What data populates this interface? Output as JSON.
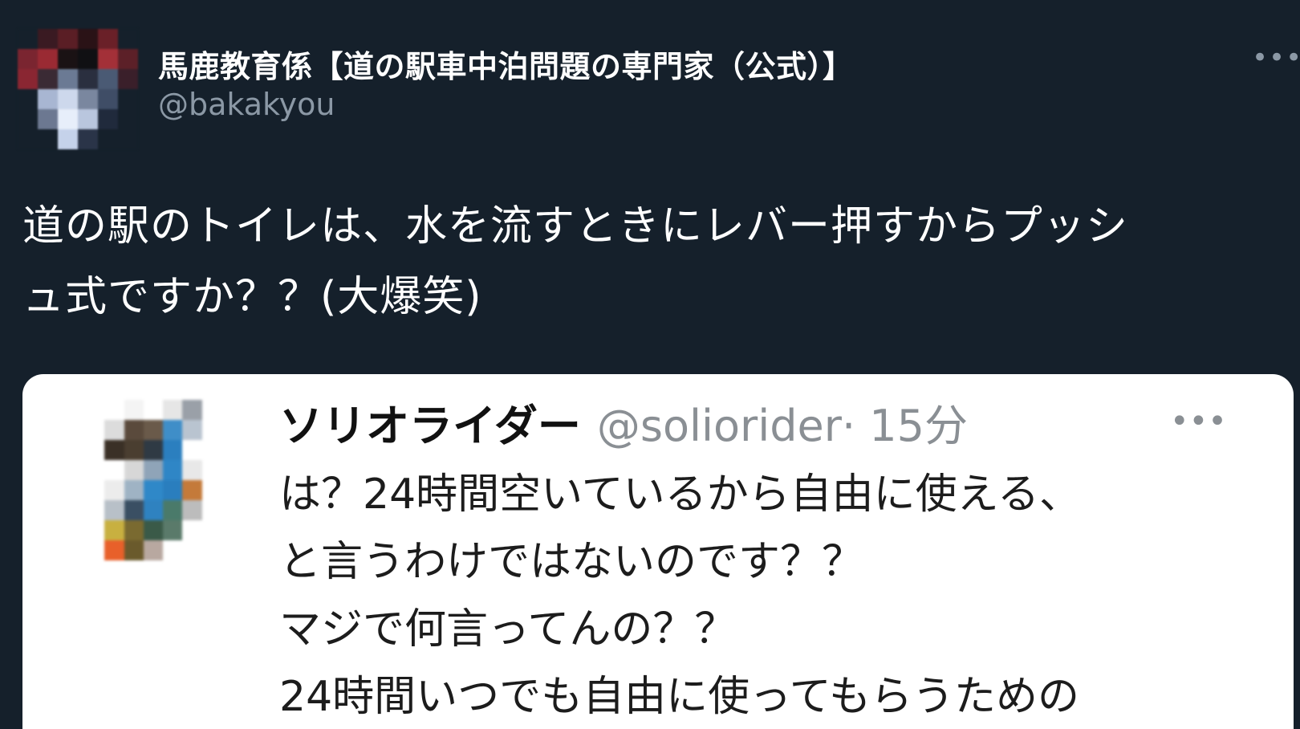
{
  "tweet": {
    "display_name": "馬鹿教育係【道の駅車中泊問題の専門家（公式）】",
    "handle": "@bakakyou",
    "more_label": "•••",
    "text": "道の駅のトイレは、水を流すときにレバー押すからプッシ\nュ式ですか？？(大爆笑)"
  },
  "quoted": {
    "display_name": "ソリオライダー",
    "handle": "@soliorider",
    "time": "· 15分",
    "more_label": "•••",
    "lines": [
      "は？24時間空いているから自由に使える、",
      "と言うわけではないのです？？",
      "マジで何言ってんの？？",
      "24時間いつでも自由に使ってもらうための"
    ]
  },
  "colors": {
    "background": "#15202b",
    "secondary_text": "#8b98a5",
    "card_background": "#ffffff"
  },
  "icons": {
    "avatar": "pixelated-avatar",
    "more": "more-horizontal-icon"
  }
}
